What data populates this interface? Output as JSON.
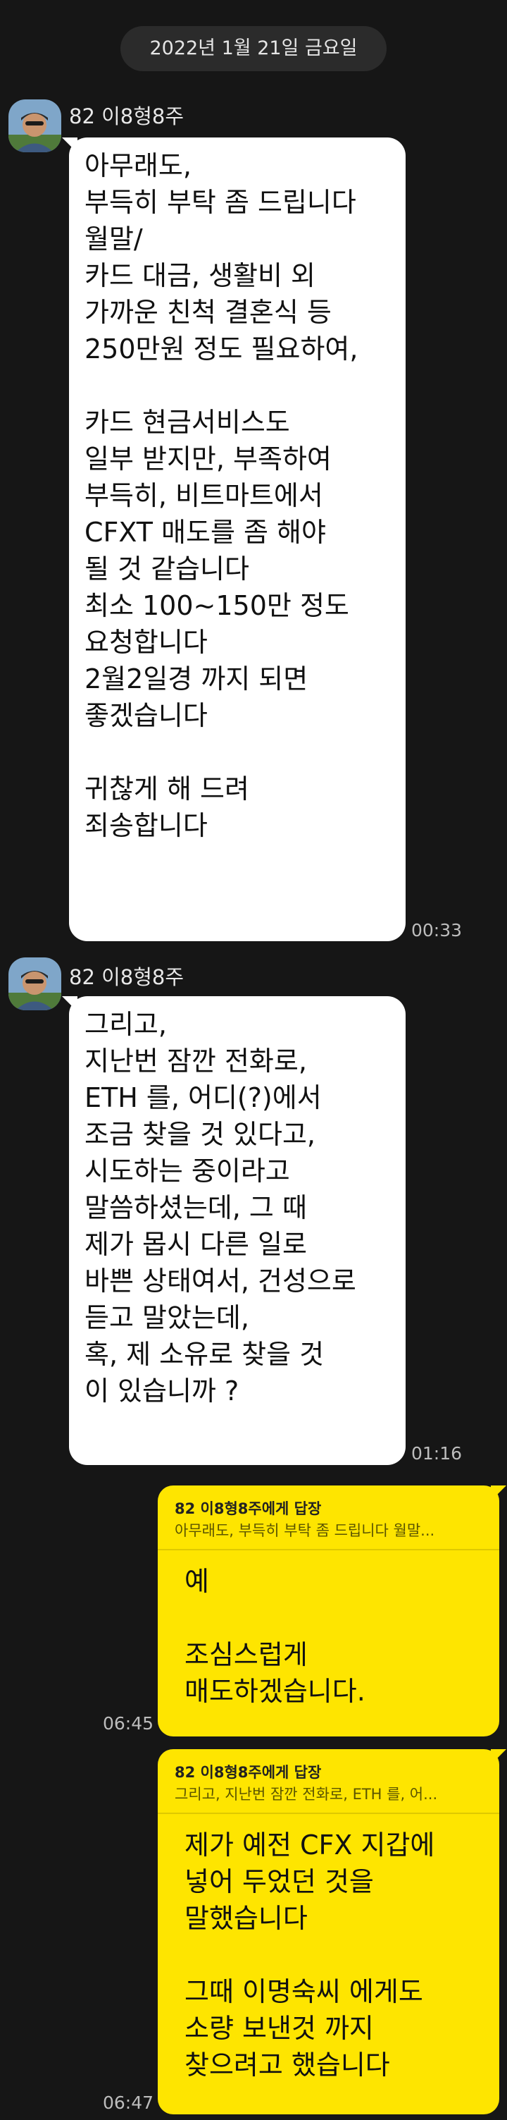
{
  "date_divider": "2022년 1월 21일 금요일",
  "incoming": [
    {
      "sender": "82 이8형8주",
      "text": "아무래도,\n부득히 부탁 좀 드립니다\n월말/\n카드 대금, 생활비 외\n가까운 친척 결혼식 등\n250만원 정도 필요하여,\n\n카드 현금서비스도\n일부 받지만, 부족하여\n부득히, 비트마트에서\nCFXT 매도를 좀 해야\n될 것 같습니다\n최소 100~150만 정도\n요청합니다\n2월2일경 까지 되면\n좋겠습니다\n\n귀찮게 해 드려\n죄송합니다",
      "time": "00:33"
    },
    {
      "sender": "82 이8형8주",
      "text": "그리고,\n지난번 잠깐 전화로,\nETH 를, 어디(?)에서\n조금 찾을 것 있다고,\n시도하는 중이라고\n말씀하셨는데, 그 때\n제가 몹시 다른 일로\n바쁜 상태여서, 건성으로\n듣고 말았는데,\n혹, 제 소유로 찾을 것\n이 있습니까 ?",
      "time": "01:16"
    }
  ],
  "outgoing": [
    {
      "reply_to": "82 이8형8주에게 답장",
      "quote": "아무래도, 부득히 부탁 좀 드립니다 월말...",
      "text": "예\n\n조심스럽게\n매도하겠습니다.",
      "time": "06:45"
    },
    {
      "reply_to": "82 이8형8주에게 답장",
      "quote": "그리고, 지난번 잠깐 전화로, ETH 를, 어...",
      "text": "제가 예전 CFX 지갑에\n넣어 두었던 것을\n말했습니다\n\n그때 이명숙씨 에게도\n소량 보낸것 까지\n찾으려고 했습니다",
      "time": "06:47"
    }
  ]
}
